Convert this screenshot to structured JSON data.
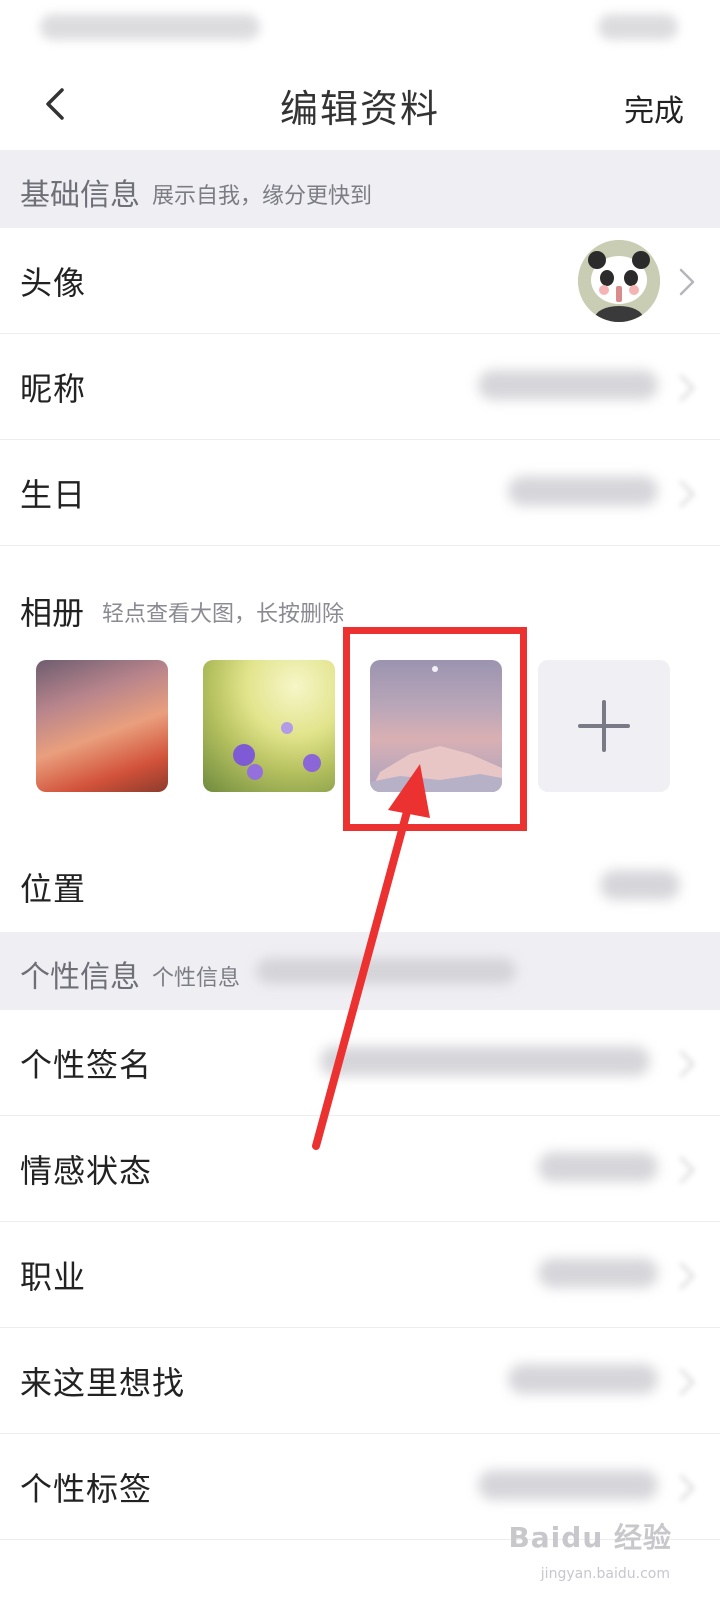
{
  "nav": {
    "title": "编辑资料",
    "done_label": "完成"
  },
  "basic_section": {
    "title": "基础信息",
    "subtitle": "展示自我，缘分更快到"
  },
  "rows_basic": {
    "avatar_label": "头像",
    "nickname_label": "昵称",
    "birthday_label": "生日"
  },
  "album": {
    "title": "相册",
    "hint": "轻点查看大图，长按删除"
  },
  "location": {
    "label": "位置"
  },
  "personal_section": {
    "title": "个性信息",
    "subtitle": "个性信息"
  },
  "rows_personal": {
    "signature_label": "个性签名",
    "relationship_label": "情感状态",
    "job_label": "职业",
    "looking_for_label": "来这里想找",
    "tags_label": "个性标签"
  },
  "watermark": {
    "brand": "Baidu 经验",
    "url": "jingyan.baidu.com"
  },
  "colors": {
    "highlight": "#ec3131",
    "section_bg": "#efeff3"
  }
}
